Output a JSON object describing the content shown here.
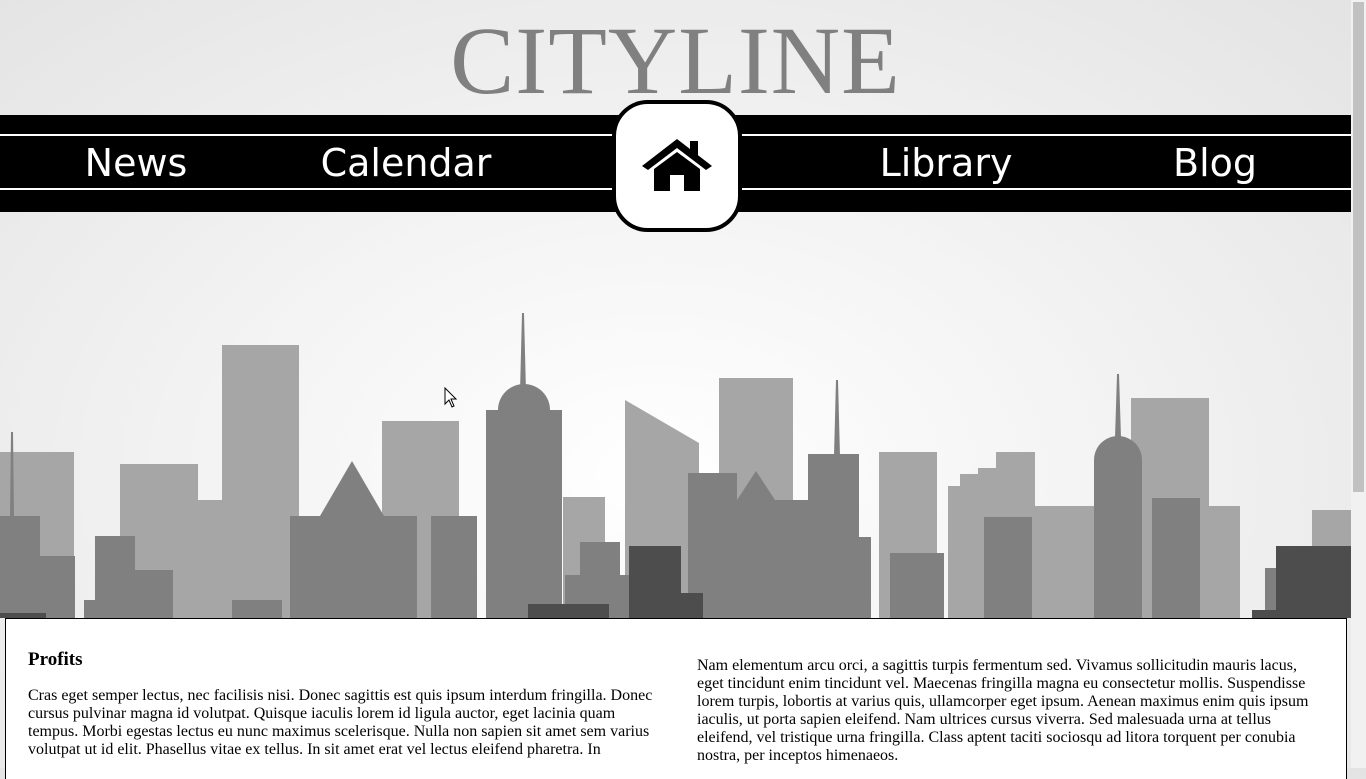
{
  "header": {
    "logo": "CITYLINE"
  },
  "nav": {
    "items": [
      {
        "label": "News"
      },
      {
        "label": "Calendar"
      },
      {
        "label": "Library"
      },
      {
        "label": "Blog"
      }
    ],
    "home_icon": "home-icon"
  },
  "content": {
    "left": {
      "heading": "Profits",
      "text": "Cras eget semper lectus, nec facilisis nisi. Donec sagittis est quis ipsum interdum fringilla. Donec cursus pulvinar magna id volutpat. Quisque iaculis lorem id ligula auctor, eget lacinia quam tempus. Morbi egestas lectus eu nunc maximus scelerisque. Nulla non sapien sit amet sem varius volutpat ut id elit. Phasellus vitae ex tellus. In sit amet erat vel lectus eleifend pharetra. In"
    },
    "right": {
      "text": "Nam elementum arcu orci, a sagittis turpis fermentum sed. Vivamus sollicitudin mauris lacus, eget tincidunt enim tincidunt vel. Maecenas fringilla magna eu consectetur mollis. Suspendisse lorem turpis, lobortis at varius quis, ullamcorper eget ipsum. Aenean maximus enim quis ipsum iaculis, ut porta sapien eleifend. Nam ultrices cursus viverra. Sed malesuada urna at tellus eleifend, vel tristique urna fringilla. Class aptent taciti sociosqu ad litora torquent per conubia nostra, per inceptos himenaeos."
    }
  },
  "colors": {
    "logo": "#808080",
    "nav_bg": "#000000",
    "nav_text": "#ffffff",
    "skyline_light": "#a6a6a6",
    "skyline_mid": "#808080",
    "skyline_dark": "#4d4d4d"
  }
}
